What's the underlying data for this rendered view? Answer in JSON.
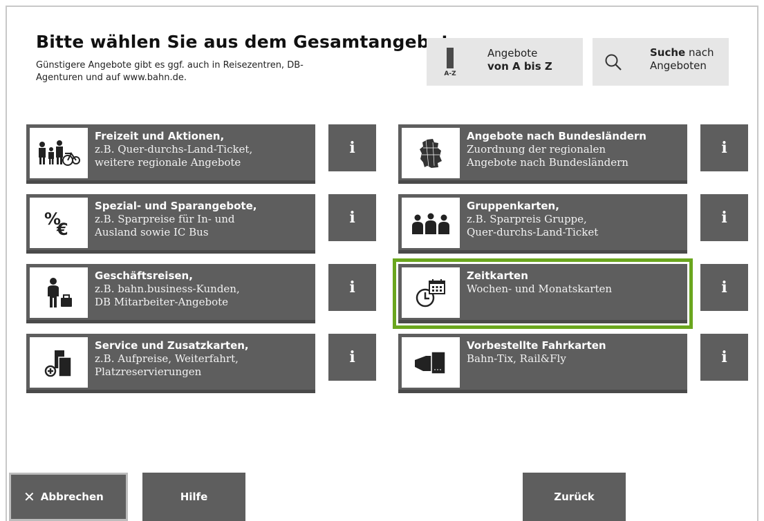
{
  "header": {
    "title": "Bitte wählen Sie aus dem Gesamtangebot.",
    "subtitle": "Günstigere Angebote gibt es ggf. auch in Reisezentren, DB-Agenturen und auf www.bahn.de."
  },
  "az_button": {
    "icon_label": "A-Z",
    "line1": "Angebote",
    "line2": "von A bis Z"
  },
  "search_button": {
    "bold": "Suche",
    "rest": "nach",
    "line2": "Angeboten"
  },
  "tiles": [
    {
      "head": "Freizeit und Aktionen,",
      "line2": "z.B. Quer-durchs-Land-Ticket,",
      "line3": "weitere regionale Angebote",
      "icon": "family-bike-icon"
    },
    {
      "head": "Angebote nach Bundesländern",
      "line2": "Zuordnung der regionalen",
      "line3": "Angebote nach Bundesländern",
      "icon": "germany-map-icon"
    },
    {
      "head": "Spezial- und Sparangebote,",
      "line2": "z.B. Sparpreise für In- und",
      "line3": "Ausland sowie IC Bus",
      "icon": "percent-euro-icon",
      "icon_text": "%€"
    },
    {
      "head": "Gruppenkarten,",
      "line2": "z.B. Sparpreis Gruppe,",
      "line3": "Quer-durchs-Land-Ticket",
      "icon": "group-icon"
    },
    {
      "head": "Geschäftsreisen,",
      "line2": "z.B. bahn.business-Kunden,",
      "line3": "DB Mitarbeiter-Angebote",
      "icon": "businessman-icon"
    },
    {
      "head": "Zeitkarten",
      "line2": "Wochen- und Monatskarten",
      "line3": "",
      "icon": "clock-calendar-icon",
      "selected": true
    },
    {
      "head": "Service und Zusatzkarten,",
      "line2": "z.B. Aufpreise, Weiterfahrt,",
      "line3": "Platzreservierungen",
      "icon": "add-ticket-icon"
    },
    {
      "head": "Vorbestellte Fahrkarten",
      "line2": "Bahn-Tix, Rail&Fly",
      "line3": "",
      "icon": "hand-ticket-icon"
    }
  ],
  "info_label": "i",
  "footer": {
    "cancel": "Abbrechen",
    "cancel_icon": "✕",
    "help": "Hilfe",
    "back": "Zurück"
  },
  "colors": {
    "tile_bg": "#5e5e5e",
    "selected_border": "#6aa61e",
    "top_button_bg": "#e6e6e6"
  }
}
